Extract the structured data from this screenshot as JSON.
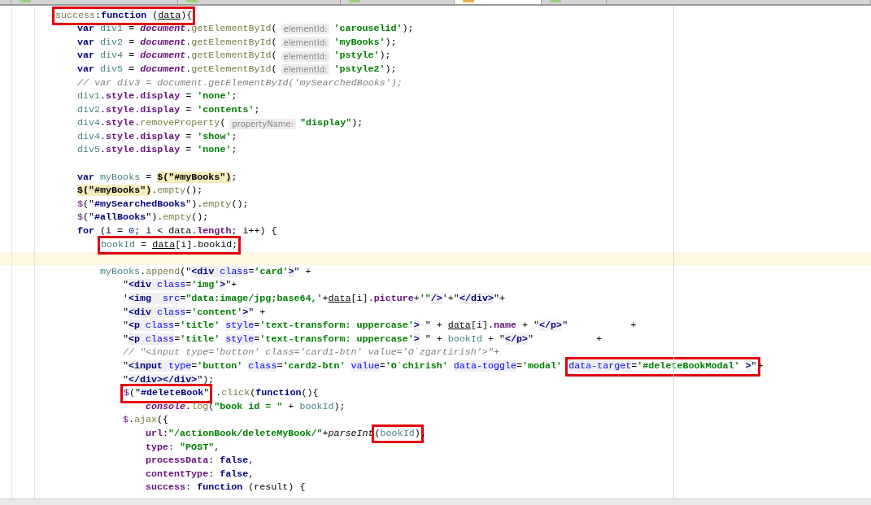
{
  "tabs": [
    {
      "selected": false
    },
    {
      "selected": false
    },
    {
      "selected": false
    },
    {
      "selected": false
    },
    {
      "selected": true
    },
    {
      "selected": false
    },
    {
      "selected": false
    }
  ],
  "lines": [
    {
      "current": false,
      "tokens": [
        {
          "kind": "boxed",
          "tokens": [
            {
              "kind": "fn",
              "text": "success"
            },
            {
              "kind": "p",
              "text": ":"
            },
            {
              "kind": "kw",
              "text": "function"
            },
            {
              "kind": "p",
              "text": " ("
            },
            {
              "kind": "ul",
              "text": "data"
            },
            {
              "kind": "p",
              "text": "){"
            }
          ]
        }
      ],
      "children": [
        {
          "current": false,
          "tokens": [
            {
              "kind": "kw",
              "text": "var "
            },
            {
              "kind": "var",
              "text": "div1"
            },
            {
              "kind": "p",
              "text": " = "
            },
            {
              "kind": "glob",
              "text": "document"
            },
            {
              "kind": "p",
              "text": "."
            },
            {
              "kind": "fn",
              "text": "getElementById"
            },
            {
              "kind": "p",
              "text": "("
            },
            {
              "kind": "hint",
              "text": "elementId:"
            },
            {
              "kind": "str",
              "text": "'carouselid'"
            },
            {
              "kind": "p",
              "text": ");"
            }
          ]
        },
        {
          "current": false,
          "tokens": [
            {
              "kind": "kw",
              "text": "var "
            },
            {
              "kind": "var",
              "text": "div2"
            },
            {
              "kind": "p",
              "text": " = "
            },
            {
              "kind": "glob",
              "text": "document"
            },
            {
              "kind": "p",
              "text": "."
            },
            {
              "kind": "fn",
              "text": "getElementById"
            },
            {
              "kind": "p",
              "text": "("
            },
            {
              "kind": "hint",
              "text": "elementId:"
            },
            {
              "kind": "str",
              "text": "'myBooks'"
            },
            {
              "kind": "p",
              "text": ");"
            }
          ]
        },
        {
          "current": false,
          "tokens": [
            {
              "kind": "kw",
              "text": "var "
            },
            {
              "kind": "var",
              "text": "div4"
            },
            {
              "kind": "p",
              "text": " = "
            },
            {
              "kind": "glob",
              "text": "document"
            },
            {
              "kind": "p",
              "text": "."
            },
            {
              "kind": "fn",
              "text": "getElementById"
            },
            {
              "kind": "p",
              "text": "("
            },
            {
              "kind": "hint",
              "text": "elementId:"
            },
            {
              "kind": "str",
              "text": "'pstyle'"
            },
            {
              "kind": "p",
              "text": ");"
            }
          ]
        },
        {
          "current": false,
          "tokens": [
            {
              "kind": "kw",
              "text": "var "
            },
            {
              "kind": "var",
              "text": "div5"
            },
            {
              "kind": "p",
              "text": " = "
            },
            {
              "kind": "glob",
              "text": "document"
            },
            {
              "kind": "p",
              "text": "."
            },
            {
              "kind": "fn",
              "text": "getElementById"
            },
            {
              "kind": "p",
              "text": "("
            },
            {
              "kind": "hint",
              "text": "elementId:"
            },
            {
              "kind": "str",
              "text": "'pstyle2'"
            },
            {
              "kind": "p",
              "text": ");"
            }
          ]
        },
        {
          "current": false,
          "tokens": [
            {
              "kind": "cmt",
              "text": "// var div3 = document.getElementById('mySearchedBooks');"
            }
          ]
        },
        {
          "current": false,
          "tokens": [
            {
              "kind": "var",
              "text": "div1"
            },
            {
              "kind": "p",
              "text": "."
            },
            {
              "kind": "prop",
              "text": "style"
            },
            {
              "kind": "p",
              "text": "."
            },
            {
              "kind": "prop",
              "text": "display"
            },
            {
              "kind": "p",
              "text": " = "
            },
            {
              "kind": "str",
              "text": "'none'"
            },
            {
              "kind": "p",
              "text": ";"
            }
          ]
        },
        {
          "current": false,
          "tokens": [
            {
              "kind": "var",
              "text": "div2"
            },
            {
              "kind": "p",
              "text": "."
            },
            {
              "kind": "prop",
              "text": "style"
            },
            {
              "kind": "p",
              "text": "."
            },
            {
              "kind": "prop",
              "text": "display"
            },
            {
              "kind": "p",
              "text": " = "
            },
            {
              "kind": "str",
              "text": "'contents'"
            },
            {
              "kind": "p",
              "text": ";"
            }
          ]
        },
        {
          "current": false,
          "tokens": [
            {
              "kind": "var",
              "text": "div4"
            },
            {
              "kind": "p",
              "text": "."
            },
            {
              "kind": "prop",
              "text": "style"
            },
            {
              "kind": "p",
              "text": "."
            },
            {
              "kind": "fn",
              "text": "removeProperty"
            },
            {
              "kind": "p",
              "text": "("
            },
            {
              "kind": "hint",
              "text": "propertyName:"
            },
            {
              "kind": "str",
              "text": "\"display\""
            },
            {
              "kind": "p",
              "text": ");"
            }
          ]
        },
        {
          "current": false,
          "tokens": [
            {
              "kind": "var",
              "text": "div4"
            },
            {
              "kind": "p",
              "text": "."
            },
            {
              "kind": "prop",
              "text": "style"
            },
            {
              "kind": "p",
              "text": "."
            },
            {
              "kind": "prop",
              "text": "display"
            },
            {
              "kind": "p",
              "text": " = "
            },
            {
              "kind": "str",
              "text": "'show'"
            },
            {
              "kind": "p",
              "text": ";"
            }
          ]
        },
        {
          "current": false,
          "tokens": [
            {
              "kind": "var",
              "text": "div5"
            },
            {
              "kind": "p",
              "text": "."
            },
            {
              "kind": "prop",
              "text": "style"
            },
            {
              "kind": "p",
              "text": "."
            },
            {
              "kind": "prop",
              "text": "display"
            },
            {
              "kind": "p",
              "text": " = "
            },
            {
              "kind": "str",
              "text": "'none'"
            },
            {
              "kind": "p",
              "text": ";"
            }
          ]
        },
        {
          "current": false
        },
        {
          "current": false,
          "tokens": [
            {
              "kind": "kw",
              "text": "var "
            },
            {
              "kind": "var",
              "text": "myBooks"
            },
            {
              "kind": "p",
              "text": " = "
            },
            {
              "kind": "mark",
              "text": "$(\"#myBooks\")"
            },
            {
              "kind": "p",
              "text": ";"
            }
          ]
        },
        {
          "current": false,
          "tokens": [
            {
              "kind": "mark",
              "text": "$(\"#myBooks\")"
            },
            {
              "kind": "p",
              "text": "."
            },
            {
              "kind": "fn",
              "text": "empty"
            },
            {
              "kind": "p",
              "text": "();"
            }
          ]
        },
        {
          "current": false,
          "tokens": [
            {
              "kind": "glob2",
              "text": "$"
            },
            {
              "kind": "p",
              "text": "(\""
            },
            {
              "kind": "sel",
              "text": "#mySearchedBooks"
            },
            {
              "kind": "p",
              "text": "\")."
            },
            {
              "kind": "fn",
              "text": "empty"
            },
            {
              "kind": "p",
              "text": "();"
            }
          ]
        },
        {
          "current": false,
          "tokens": [
            {
              "kind": "glob2",
              "text": "$"
            },
            {
              "kind": "p",
              "text": "(\""
            },
            {
              "kind": "sel",
              "text": "#allBooks"
            },
            {
              "kind": "p",
              "text": "\")."
            },
            {
              "kind": "fn",
              "text": "empty"
            },
            {
              "kind": "p",
              "text": "();"
            }
          ]
        },
        {
          "current": false,
          "tokens": [
            {
              "kind": "kw",
              "text": "for"
            },
            {
              "kind": "p",
              "text": " (i = "
            },
            {
              "kind": "num",
              "text": "0"
            },
            {
              "kind": "p",
              "text": "; i < data."
            },
            {
              "kind": "prop",
              "text": "length"
            },
            {
              "kind": "p",
              "text": "; i++) {"
            }
          ],
          "children": [
            {
              "current": false,
              "tokens": [
                {
                  "kind": "boxed",
                  "tokens": [
                    {
                      "kind": "var",
                      "text": "bookId"
                    },
                    {
                      "kind": "p",
                      "text": " = "
                    },
                    {
                      "kind": "ul",
                      "text": "data"
                    },
                    {
                      "kind": "p",
                      "text": "[i].bookid;"
                    }
                  ]
                }
              ]
            },
            {
              "current": true
            },
            {
              "current": false,
              "tokens": [
                {
                  "kind": "var",
                  "text": "myBooks"
                },
                {
                  "kind": "p",
                  "text": "."
                },
                {
                  "kind": "fn",
                  "text": "append"
                },
                {
                  "kind": "p",
                  "text": "(\""
                },
                {
                  "kind": "tag",
                  "text": "<div "
                },
                {
                  "kind": "attr",
                  "text": "class"
                },
                {
                  "kind": "p",
                  "text": "="
                },
                {
                  "kind": "str",
                  "text": "'card'"
                },
                {
                  "kind": "tag",
                  "text": ">"
                },
                {
                  "kind": "p",
                  "text": "\" +"
                }
              ],
              "children": [
                {
                  "current": false,
                  "tokens": [
                    {
                      "kind": "p",
                      "text": "\""
                    },
                    {
                      "kind": "tag",
                      "text": "<div "
                    },
                    {
                      "kind": "attr",
                      "text": "class"
                    },
                    {
                      "kind": "p",
                      "text": "="
                    },
                    {
                      "kind": "str",
                      "text": "'img'"
                    },
                    {
                      "kind": "tag",
                      "text": ">"
                    },
                    {
                      "kind": "p",
                      "text": "\"+"
                    }
                  ]
                },
                {
                  "current": false,
                  "tokens": [
                    {
                      "kind": "p",
                      "text": "'"
                    },
                    {
                      "kind": "tag",
                      "text": "<img  "
                    },
                    {
                      "kind": "attr",
                      "text": "src"
                    },
                    {
                      "kind": "p",
                      "text": "="
                    },
                    {
                      "kind": "str",
                      "text": "\"data:image/jpg;base64,"
                    },
                    {
                      "kind": "p",
                      "text": "'+"
                    },
                    {
                      "kind": "ul",
                      "text": "data"
                    },
                    {
                      "kind": "p",
                      "text": "[i]."
                    },
                    {
                      "kind": "prop",
                      "text": "picture"
                    },
                    {
                      "kind": "p",
                      "text": "+'"
                    },
                    {
                      "kind": "str",
                      "text": "\""
                    },
                    {
                      "kind": "tag",
                      "text": "/>"
                    },
                    {
                      "kind": "p",
                      "text": "'+\""
                    },
                    {
                      "kind": "tag",
                      "text": "</div>"
                    },
                    {
                      "kind": "p",
                      "text": "\"+"
                    }
                  ]
                },
                {
                  "current": false,
                  "tokens": [
                    {
                      "kind": "p",
                      "text": "\""
                    },
                    {
                      "kind": "tag",
                      "text": "<div "
                    },
                    {
                      "kind": "attr",
                      "text": "class"
                    },
                    {
                      "kind": "p",
                      "text": "="
                    },
                    {
                      "kind": "str",
                      "text": "'content'"
                    },
                    {
                      "kind": "tag",
                      "text": ">"
                    },
                    {
                      "kind": "p",
                      "text": "\" +"
                    }
                  ]
                },
                {
                  "current": false,
                  "tokens": [
                    {
                      "kind": "p",
                      "text": "\""
                    },
                    {
                      "kind": "tag",
                      "text": "<p "
                    },
                    {
                      "kind": "attr",
                      "text": "class"
                    },
                    {
                      "kind": "p",
                      "text": "="
                    },
                    {
                      "kind": "str",
                      "text": "'title' "
                    },
                    {
                      "kind": "attr",
                      "text": "style"
                    },
                    {
                      "kind": "p",
                      "text": "="
                    },
                    {
                      "kind": "str",
                      "text": "'text-transform: uppercase'"
                    },
                    {
                      "kind": "tag",
                      "text": ">"
                    },
                    {
                      "kind": "p",
                      "text": " \" + "
                    },
                    {
                      "kind": "ul",
                      "text": "data"
                    },
                    {
                      "kind": "p",
                      "text": "[i]."
                    },
                    {
                      "kind": "prop",
                      "text": "name"
                    },
                    {
                      "kind": "p",
                      "text": " + \""
                    },
                    {
                      "kind": "tag",
                      "text": "</p>"
                    },
                    {
                      "kind": "p",
                      "text": "\"           +"
                    }
                  ]
                },
                {
                  "current": false,
                  "tokens": [
                    {
                      "kind": "p",
                      "text": "\""
                    },
                    {
                      "kind": "tag",
                      "text": "<p "
                    },
                    {
                      "kind": "attr",
                      "text": "class"
                    },
                    {
                      "kind": "p",
                      "text": "="
                    },
                    {
                      "kind": "str",
                      "text": "'title' "
                    },
                    {
                      "kind": "attr",
                      "text": "style"
                    },
                    {
                      "kind": "p",
                      "text": "="
                    },
                    {
                      "kind": "str",
                      "text": "'text-transform: uppercase'"
                    },
                    {
                      "kind": "tag",
                      "text": ">"
                    },
                    {
                      "kind": "p",
                      "text": " \" + "
                    },
                    {
                      "kind": "var",
                      "text": "bookId"
                    },
                    {
                      "kind": "p",
                      "text": " + \""
                    },
                    {
                      "kind": "tag",
                      "text": "</p>"
                    },
                    {
                      "kind": "p",
                      "text": "\"           +"
                    }
                  ]
                },
                {
                  "current": false,
                  "tokens": [
                    {
                      "kind": "cmt",
                      "text": "// \"<input type='button' class='card1-btn' value='O`zgartirish'>\"+"
                    }
                  ]
                },
                {
                  "current": false,
                  "tokens": [
                    {
                      "kind": "p",
                      "text": "\""
                    },
                    {
                      "kind": "tag",
                      "text": "<input "
                    },
                    {
                      "kind": "attr",
                      "text": "type"
                    },
                    {
                      "kind": "p",
                      "text": "="
                    },
                    {
                      "kind": "str",
                      "text": "'button' "
                    },
                    {
                      "kind": "attr",
                      "text": "class"
                    },
                    {
                      "kind": "p",
                      "text": "="
                    },
                    {
                      "kind": "str",
                      "text": "'card2-btn' "
                    },
                    {
                      "kind": "attr",
                      "text": "value"
                    },
                    {
                      "kind": "p",
                      "text": "="
                    },
                    {
                      "kind": "str",
                      "text": "'O`chirish' "
                    },
                    {
                      "kind": "attr",
                      "text": "data-toggle"
                    },
                    {
                      "kind": "p",
                      "text": "="
                    },
                    {
                      "kind": "str",
                      "text": "'modal' "
                    },
                    {
                      "kind": "boxed",
                      "tokens": [
                        {
                          "kind": "attr",
                          "text": "data-target"
                        },
                        {
                          "kind": "p",
                          "text": "="
                        },
                        {
                          "kind": "str",
                          "text": "'#deleteBookModal' "
                        },
                        {
                          "kind": "tag",
                          "text": ">"
                        },
                        {
                          "kind": "p",
                          "text": "\""
                        }
                      ]
                    },
                    {
                      "kind": "p",
                      "text": "+"
                    }
                  ]
                },
                {
                  "current": false,
                  "tokens": [
                    {
                      "kind": "p",
                      "text": "\""
                    },
                    {
                      "kind": "tag",
                      "text": "</div></div>"
                    },
                    {
                      "kind": "p",
                      "text": "\");"
                    }
                  ]
                },
                {
                  "current": false,
                  "tokens": [
                    {
                      "kind": "boxed",
                      "tokens": [
                        {
                          "kind": "glob2",
                          "text": "$"
                        },
                        {
                          "kind": "p",
                          "text": "(\""
                        },
                        {
                          "kind": "sel",
                          "text": "#deleteBook"
                        },
                        {
                          "kind": "p",
                          "text": "\""
                        }
                      ]
                    },
                    {
                      "kind": "p",
                      "text": " ."
                    },
                    {
                      "kind": "fn",
                      "text": "click"
                    },
                    {
                      "kind": "p",
                      "text": "("
                    },
                    {
                      "kind": "kw",
                      "text": "function"
                    },
                    {
                      "kind": "p",
                      "text": "(){"
                    }
                  ],
                  "children": [
                    {
                      "current": false,
                      "tokens": [
                        {
                          "kind": "glob",
                          "text": "console"
                        },
                        {
                          "kind": "p",
                          "text": "."
                        },
                        {
                          "kind": "fn",
                          "text": "log"
                        },
                        {
                          "kind": "p",
                          "text": "("
                        },
                        {
                          "kind": "str",
                          "text": "\"book id = \""
                        },
                        {
                          "kind": "p",
                          "text": " + "
                        },
                        {
                          "kind": "var",
                          "text": "bookId"
                        },
                        {
                          "kind": "p",
                          "text": ");"
                        }
                      ]
                    }
                  ]
                },
                {
                  "current": false,
                  "tokens": [
                    {
                      "kind": "glob2",
                      "text": "$"
                    },
                    {
                      "kind": "p",
                      "text": "."
                    },
                    {
                      "kind": "fn",
                      "text": "ajax"
                    },
                    {
                      "kind": "p",
                      "text": "({"
                    }
                  ],
                  "children": [
                    {
                      "current": false,
                      "tokens": [
                        {
                          "kind": "prop",
                          "text": "url"
                        },
                        {
                          "kind": "p",
                          "text": ":"
                        },
                        {
                          "kind": "str",
                          "text": "\"/actionBook/deleteMyBook/\""
                        },
                        {
                          "kind": "p",
                          "text": "+"
                        },
                        {
                          "kind": "glob3",
                          "text": "parseInt"
                        },
                        {
                          "kind": "boxed",
                          "tokens": [
                            {
                              "kind": "p",
                              "text": "("
                            },
                            {
                              "kind": "var",
                              "text": "bookId"
                            },
                            {
                              "kind": "p",
                              "text": ")"
                            }
                          ]
                        },
                        {
                          "kind": "p",
                          "text": ","
                        }
                      ]
                    },
                    {
                      "current": false,
                      "tokens": [
                        {
                          "kind": "prop",
                          "text": "type"
                        },
                        {
                          "kind": "p",
                          "text": ": "
                        },
                        {
                          "kind": "str",
                          "text": "\"POST\""
                        },
                        {
                          "kind": "p",
                          "text": ","
                        }
                      ]
                    },
                    {
                      "current": false,
                      "tokens": [
                        {
                          "kind": "prop",
                          "text": "processData"
                        },
                        {
                          "kind": "p",
                          "text": ": "
                        },
                        {
                          "kind": "kw",
                          "text": "false"
                        },
                        {
                          "kind": "p",
                          "text": ","
                        }
                      ]
                    },
                    {
                      "current": false,
                      "tokens": [
                        {
                          "kind": "prop",
                          "text": "contentType"
                        },
                        {
                          "kind": "p",
                          "text": ": "
                        },
                        {
                          "kind": "kw",
                          "text": "false"
                        },
                        {
                          "kind": "p",
                          "text": ","
                        }
                      ]
                    },
                    {
                      "current": false,
                      "tokens": [
                        {
                          "kind": "prop",
                          "text": "success"
                        },
                        {
                          "kind": "p",
                          "text": ": "
                        },
                        {
                          "kind": "kw",
                          "text": "function"
                        },
                        {
                          "kind": "p",
                          "text": " (result) {"
                        }
                      ]
                    }
                  ]
                }
              ]
            }
          ]
        }
      ]
    }
  ]
}
